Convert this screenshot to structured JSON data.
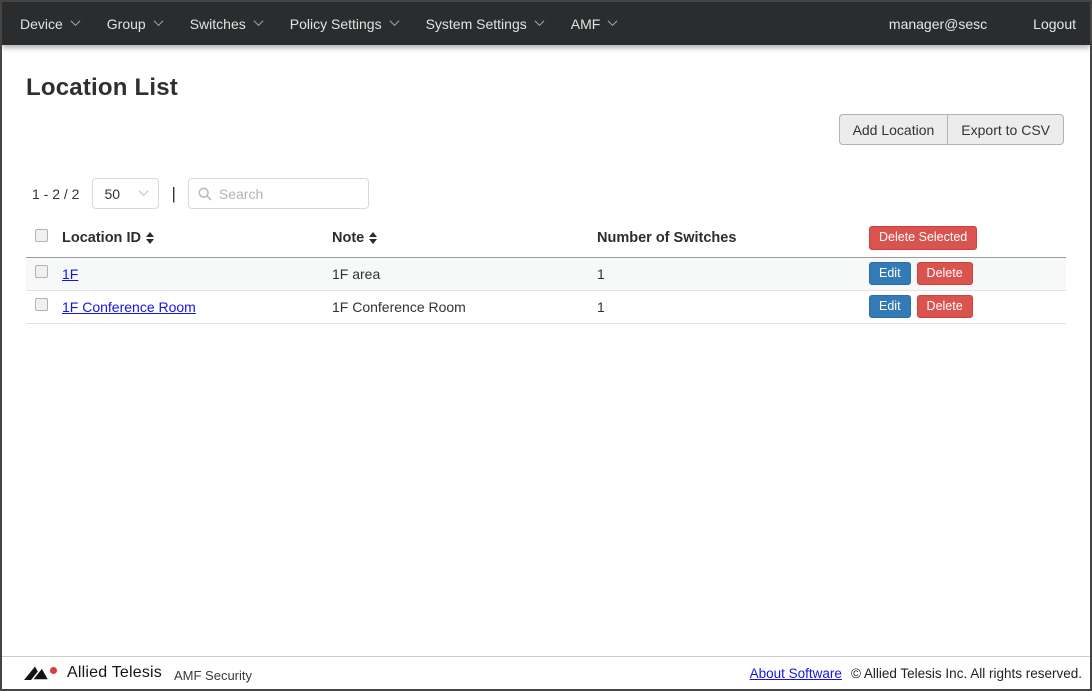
{
  "navbar": {
    "items": [
      {
        "label": "Device"
      },
      {
        "label": "Group"
      },
      {
        "label": "Switches"
      },
      {
        "label": "Policy Settings"
      },
      {
        "label": "System Settings"
      },
      {
        "label": "AMF"
      }
    ],
    "user": "manager@sesc",
    "logout_label": "Logout"
  },
  "page": {
    "title": "Location List"
  },
  "toolbar": {
    "add_location_label": "Add Location",
    "export_csv_label": "Export to CSV"
  },
  "list_controls": {
    "range": "1 - 2 / 2",
    "page_size": "50",
    "separator": "|",
    "search_placeholder": "Search"
  },
  "table": {
    "headers": {
      "location_id": "Location ID",
      "note": "Note",
      "switches": "Number of Switches"
    },
    "delete_selected_label": "Delete Selected",
    "row_actions": {
      "edit": "Edit",
      "delete": "Delete"
    },
    "rows": [
      {
        "location_id": "1F",
        "note": "1F area",
        "switches": "1"
      },
      {
        "location_id": "1F Conference Room",
        "note": "1F Conference Room",
        "switches": "1"
      }
    ]
  },
  "footer": {
    "brand": "Allied Telesis",
    "product": "AMF Security",
    "about_label": "About Software",
    "copyright": "© Allied Telesis Inc. All rights reserved."
  },
  "colors": {
    "navbar_bg": "#2a2c2e",
    "primary": "#337ab7",
    "danger": "#d9534f",
    "link": "#1414e6",
    "row_stripe": "#f7f8f8"
  }
}
